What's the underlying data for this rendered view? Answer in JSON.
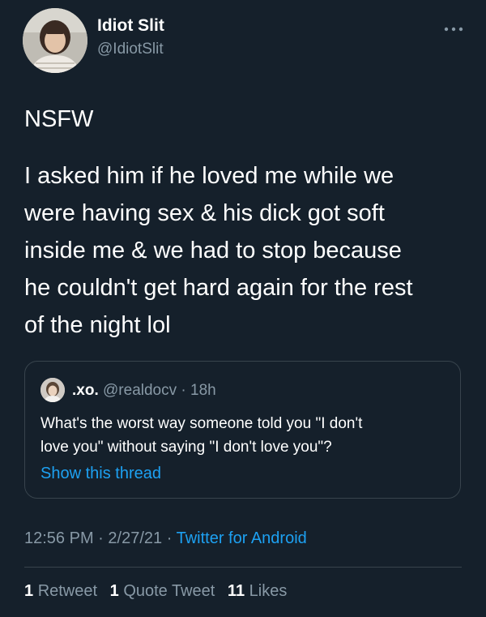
{
  "author": {
    "display_name": "Idiot Slit",
    "handle": "@IdiotSlit"
  },
  "tweet": {
    "lines": [
      "NSFW",
      "I asked him if he loved me while we",
      "were having sex & his dick got soft",
      "inside me & we had to stop because",
      "he couldn't get hard again for the rest",
      "of the night lol"
    ]
  },
  "quoted": {
    "name": ".xo.",
    "handle": "@realdocv",
    "separator": "·",
    "time": "18h",
    "text_lines": [
      "What's the worst way someone told you \"I don't",
      "love you\" without saying \"I don't love you\"?"
    ],
    "show_thread": "Show this thread"
  },
  "meta": {
    "time": "12:56 PM",
    "separator": "·",
    "date": "2/27/21",
    "source": "Twitter for Android"
  },
  "stats": {
    "retweets_count": "1",
    "retweets_label": "Retweet",
    "quote_count": "1",
    "quote_label": "Quote Tweet",
    "likes_count": "11",
    "likes_label": "Likes"
  },
  "icons": {
    "more": "more-horizontal-icon"
  },
  "colors": {
    "background": "#15202b",
    "text": "#ffffff",
    "secondary_text": "#8899a6",
    "link": "#1da1f2",
    "border": "#38444d"
  }
}
